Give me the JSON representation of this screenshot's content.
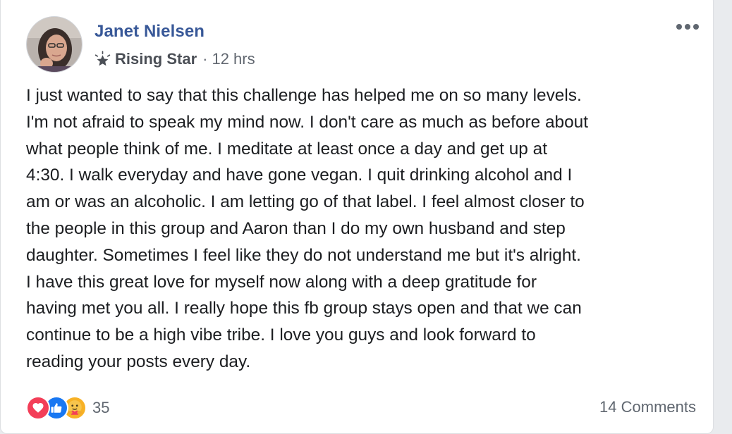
{
  "post": {
    "author": "Janet Nielsen",
    "badge": "Rising Star",
    "separator": "·",
    "time": "12 hrs",
    "text": "I just wanted to say that this challenge has helped me on so many levels.\nI'm not afraid to speak my mind now. I don't care as much as before about\nwhat people think of me. I meditate at least once a day and get up at\n4:30. I walk everyday and have gone vegan. I quit drinking alcohol and I\nam or was an alcoholic. I am letting go of that label. I feel almost closer to\nthe people in this group and Aaron than I do my own husband and step\ndaughter. Sometimes I feel like they do not understand me but it's alright.\nI have this great love for myself now along with a deep gratitude for\nhaving met you all. I really hope this fb group stays open and that we can\ncontinue to be a high vibe tribe. I love you guys and look forward to\nreading your posts every day."
  },
  "reactions": {
    "icons": [
      "love-icon",
      "like-icon",
      "care-icon"
    ],
    "count": "35"
  },
  "comments": {
    "label": "14 Comments"
  },
  "icons": {
    "badge": "rising-star-icon",
    "menu": "more-options-icon"
  },
  "colors": {
    "author": "#385898",
    "love": "#f33e58",
    "like": "#1877f2",
    "care": "#f7b125",
    "muted_text": "#606770"
  }
}
